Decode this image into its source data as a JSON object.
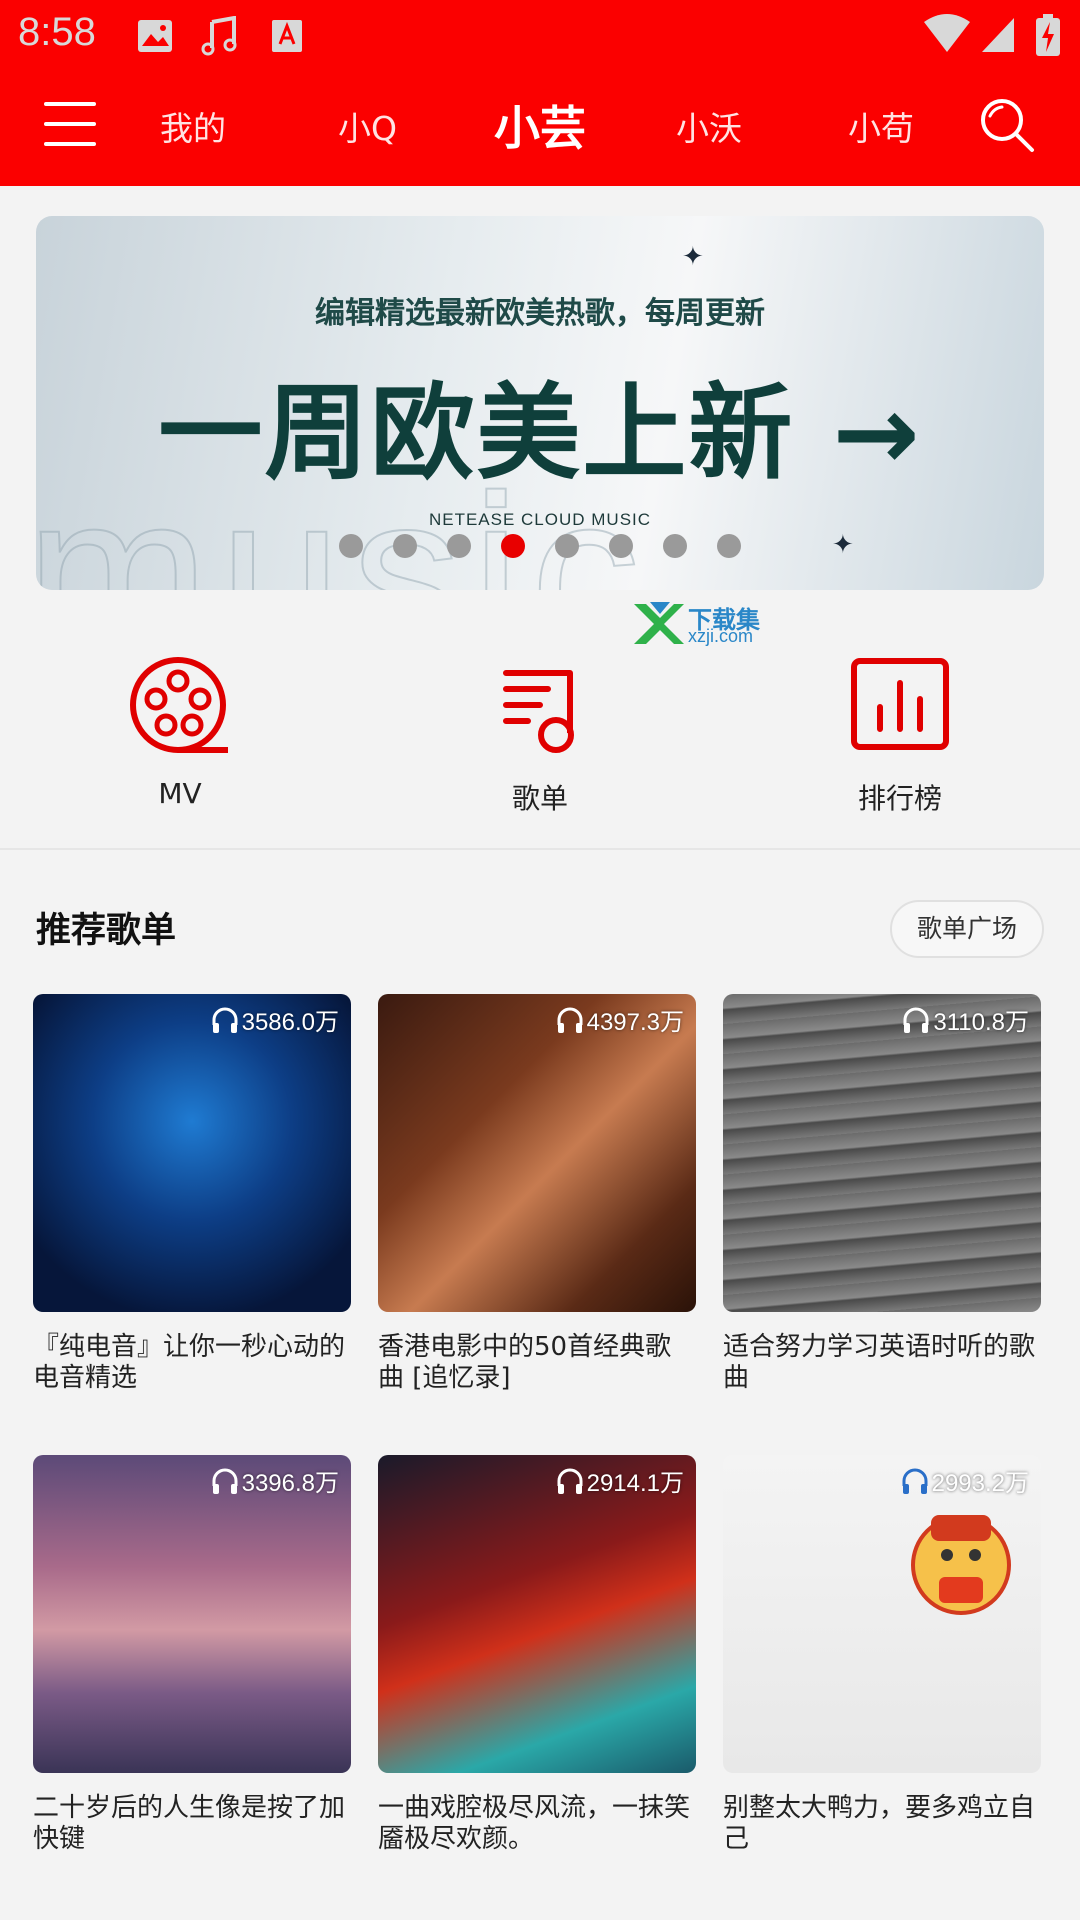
{
  "status_bar": {
    "time": "8:58"
  },
  "nav": {
    "tabs": [
      {
        "label": "我的"
      },
      {
        "label": "小Q"
      },
      {
        "label": "小芸"
      },
      {
        "label": "小沃"
      },
      {
        "label": "小苟"
      }
    ],
    "active_tab": "小芸"
  },
  "banner": {
    "subtitle": "编辑精选最新欧美热歌，每周更新",
    "headline": "一周欧美上新 →",
    "brand": "NETEASE CLOUD MUSIC",
    "bg_word": "music",
    "page_count": 8,
    "active_page": 4
  },
  "watermark": {
    "title": "下载集",
    "url": "xzji.com"
  },
  "quick_entries": [
    {
      "label": "MV",
      "icon": "film-reel-icon"
    },
    {
      "label": "歌单",
      "icon": "playlist-music-icon"
    },
    {
      "label": "排行榜",
      "icon": "bar-chart-icon"
    }
  ],
  "section": {
    "title": "推荐歌单",
    "more_label": "歌单广场"
  },
  "playlists": [
    {
      "count": "3586.0万",
      "title": "『纯电音』让你一秒心动的电音精选"
    },
    {
      "count": "4397.3万",
      "title": "香港电影中的50首经典歌曲 [追忆录]"
    },
    {
      "count": "3110.8万",
      "title": "适合努力学习英语时听的歌曲"
    },
    {
      "count": "3396.8万",
      "title": "二十岁后的人生像是按了加快键"
    },
    {
      "count": "2914.1万",
      "title": "一曲戏腔极尽风流，一抹笑靥极尽欢颜。"
    },
    {
      "count": "2993.2万",
      "title": "别整太大鸭力，要多鸡立自己"
    }
  ],
  "colors": {
    "brand": "#fb0000",
    "accent_dot": "#e80000"
  }
}
